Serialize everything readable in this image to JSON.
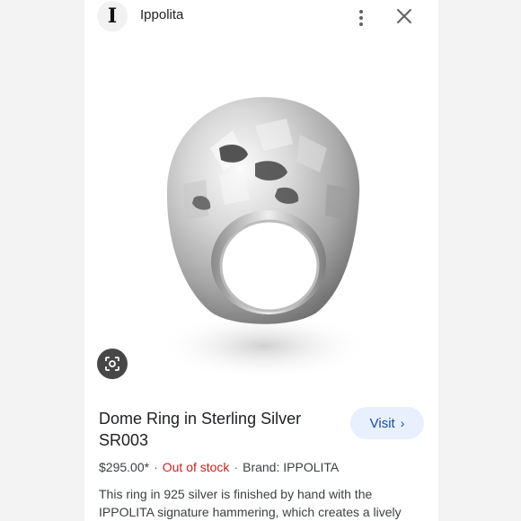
{
  "header": {
    "site_logo_letter": "I",
    "site_name": "Ippolita"
  },
  "product": {
    "title": "Dome Ring in Sterling Silver SR003",
    "visit_label": "Visit",
    "price": "$295.00*",
    "stock_status": "Out of stock",
    "brand": "Brand: IPPOLITA",
    "separator": "·",
    "description": "This ring in 925 silver is finished by hand with the IPPOLITA signature hammering, which creates a lively"
  },
  "colors": {
    "stock_red": "#c5221f",
    "visit_bg": "#e8f0fe",
    "visit_text": "#174ea6",
    "lens_bg": "#474747"
  },
  "icons": [
    "more-vert-icon",
    "close-icon",
    "google-lens-icon",
    "chevron-right-icon"
  ]
}
